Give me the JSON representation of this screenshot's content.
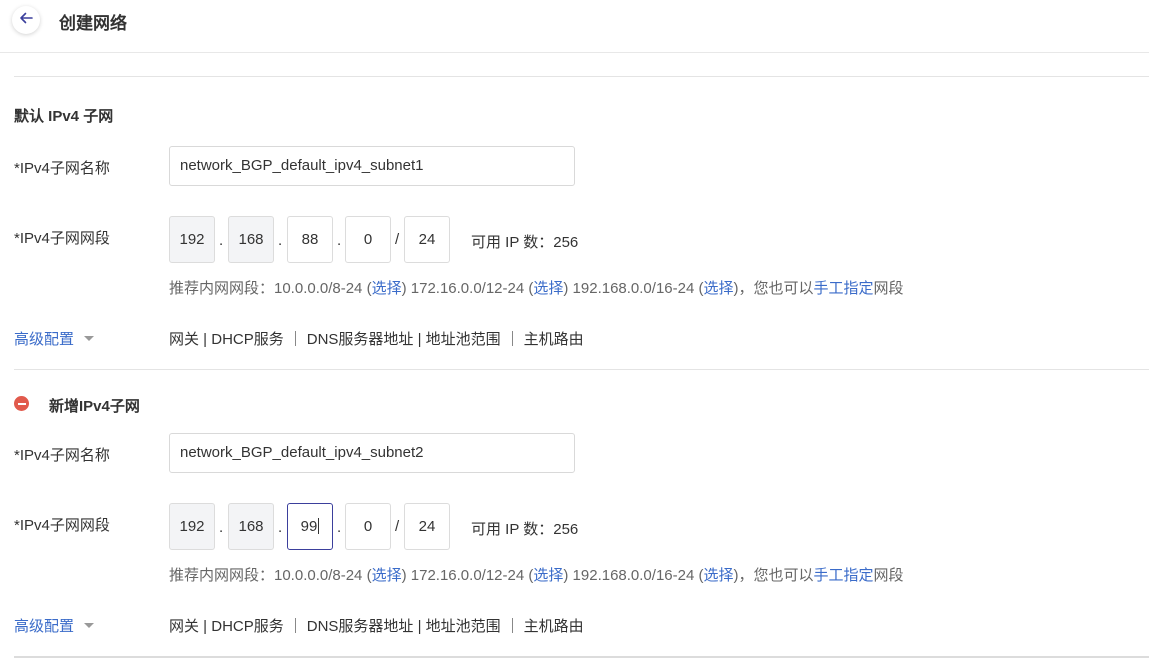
{
  "header": {
    "title": "创建网络"
  },
  "default_subnet": {
    "section_title": "默认 IPv4 子网",
    "name_label": "*IPv4子网名称",
    "name_value": "network_BGP_default_ipv4_subnet1",
    "cidr_label": "*IPv4子网网段",
    "octets": [
      "192",
      "168",
      "88",
      "0"
    ],
    "mask": "24",
    "available": "可用 IP 数：256"
  },
  "new_subnet": {
    "section_title": "新增IPv4子网",
    "name_label": "*IPv4子网名称",
    "name_value": "network_BGP_default_ipv4_subnet2",
    "cidr_label": "*IPv4子网网段",
    "octets": [
      "192",
      "168",
      "99",
      "0"
    ],
    "mask": "24",
    "available": "可用 IP 数：256"
  },
  "hint": {
    "prefix": "推荐内网网段：10.0.0.0/8-24 (",
    "select": "选择",
    "mid1": ") 172.16.0.0/12-24 (",
    "mid2": ") 192.168.0.0/16-24 (",
    "mid3": ")，您也可以",
    "manual": "手工指定",
    "suffix": "网段"
  },
  "advanced": {
    "label": "高级配置",
    "tabs": [
      "网关 | DHCP服务",
      "DNS服务器地址 | 地址池范围",
      "主机路由"
    ]
  },
  "colors": {
    "link": "#3a6bc9",
    "remove": "#e15a4c",
    "focus_border": "#3b3f9c"
  }
}
